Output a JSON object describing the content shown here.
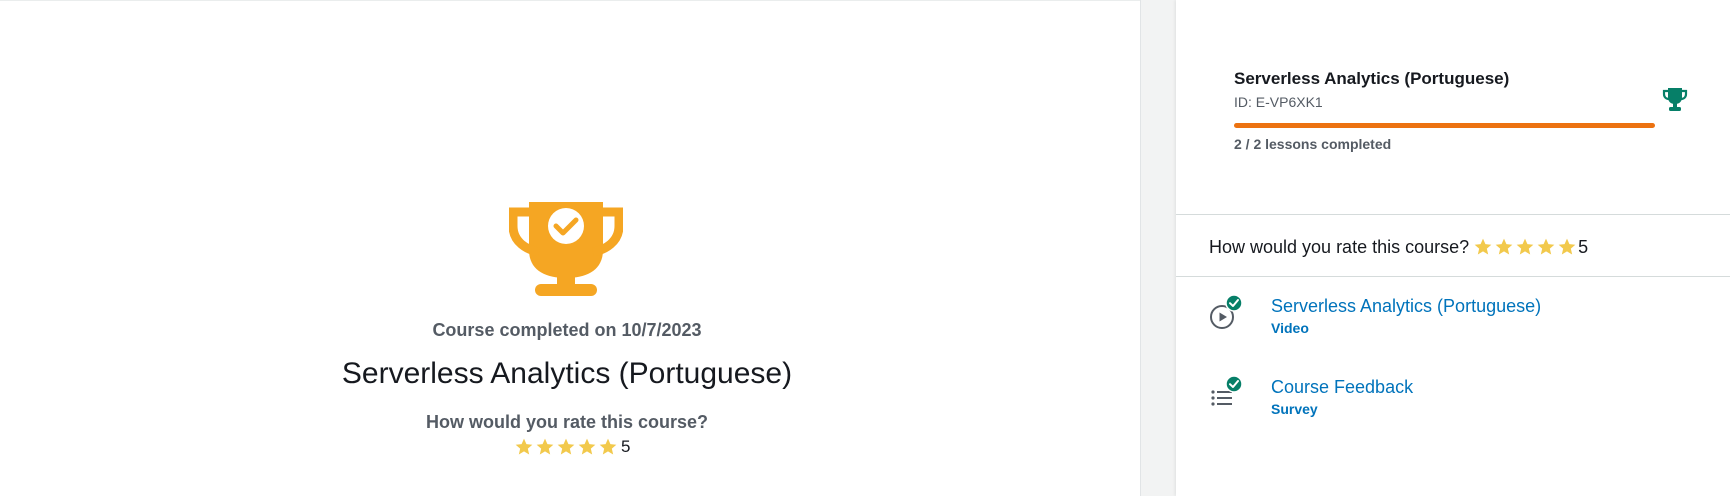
{
  "main": {
    "completed_on": "Course completed on 10/7/2023",
    "title": "Serverless Analytics (Portuguese)",
    "rate_question": "How would you rate this course?",
    "rating_value": "5",
    "rating_stars": 5
  },
  "sidebar": {
    "course_title": "Serverless Analytics (Portuguese)",
    "course_id": "ID: E-VP6XK1",
    "progress_text": "2 / 2 lessons completed",
    "progress_fraction": 1.0,
    "rate_question": "How would you rate this course?",
    "rating_value": "5",
    "rating_stars": 5,
    "lessons": [
      {
        "title": "Serverless Analytics (Portuguese)",
        "type": "Video",
        "icon": "play-circle-icon",
        "completed": true
      },
      {
        "title": "Course Feedback",
        "type": "Survey",
        "icon": "list-icon",
        "completed": true
      }
    ]
  },
  "colors": {
    "trophy_main": "#f5a623",
    "trophy_side": "#067f68",
    "progress": "#ec7211",
    "star": "#f2c94c",
    "link": "#0073bb",
    "check": "#067f68"
  }
}
